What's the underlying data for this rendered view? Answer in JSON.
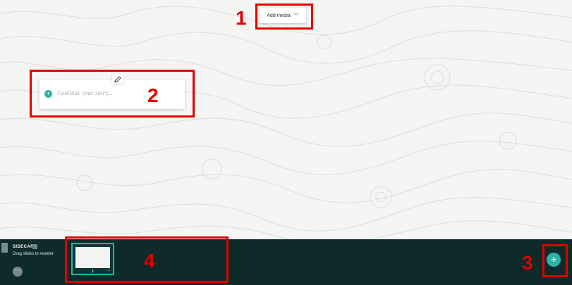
{
  "toolbar": {
    "add_media_label": "Add media",
    "add_media_chevron": "﹀"
  },
  "story": {
    "placeholder": "Continue your story..."
  },
  "sidecar": {
    "label": "SIDECAR",
    "hint": "Drag slides to reorder",
    "more_label": "···",
    "slide": {
      "number": "1",
      "more_label": "···"
    },
    "add_slide_label": "+"
  },
  "annotations": [
    "1",
    "2",
    "3",
    "4"
  ],
  "colors": {
    "accent": "#2bb3a4",
    "annotation": "#e00000",
    "bar": "#0e2a2a"
  }
}
